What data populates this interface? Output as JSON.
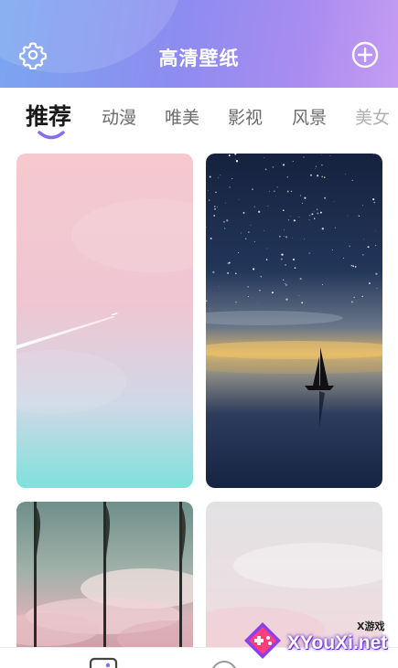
{
  "header": {
    "title": "高清壁纸",
    "settings_icon": "gear-icon",
    "add_icon": "plus-circle-icon"
  },
  "tabs": [
    {
      "label": "推荐",
      "active": true
    },
    {
      "label": "动漫",
      "active": false
    },
    {
      "label": "唯美",
      "active": false
    },
    {
      "label": "影视",
      "active": false
    },
    {
      "label": "风景",
      "active": false
    },
    {
      "label": "美女",
      "active": false
    }
  ],
  "wallpapers": [
    {
      "subject": "pink sky with airplane contrail"
    },
    {
      "subject": "starry night sea with sailboat"
    },
    {
      "subject": "flags at sunset sky"
    },
    {
      "subject": "pale pink clouds"
    }
  ],
  "bottom_nav": {
    "icons": [
      "wallpaper-icon",
      "favorite-icon"
    ]
  },
  "watermark": {
    "small": "X游戏",
    "text": "XYouXi.net"
  },
  "colors": {
    "header_start": "#7aa6f0",
    "header_end": "#c59cf2",
    "tab_indicator": "#8a6cf0"
  }
}
